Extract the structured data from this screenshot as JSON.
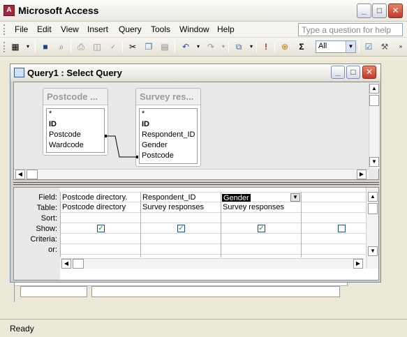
{
  "app": {
    "title": "Microsoft Access"
  },
  "menu": [
    "File",
    "Edit",
    "View",
    "Insert",
    "Query",
    "Tools",
    "Window",
    "Help"
  ],
  "ask_placeholder": "Type a question for help",
  "toolbar": {
    "filter_value": "All"
  },
  "query_window": {
    "title": "Query1 : Select Query"
  },
  "field_lists": [
    {
      "title": "Postcode ...",
      "fields": [
        "*",
        "ID",
        "Postcode",
        "Wardcode"
      ]
    },
    {
      "title": "Survey res...",
      "fields": [
        "*",
        "ID",
        "Respondent_ID",
        "Gender",
        "Postcode"
      ]
    }
  ],
  "grid": {
    "row_labels": [
      "Field:",
      "Table:",
      "Sort:",
      "Show:",
      "Criteria:",
      "or:"
    ],
    "columns": [
      {
        "field": "Postcode directory.",
        "table": "Postcode directory",
        "show": true
      },
      {
        "field": "Respondent_ID",
        "table": "Survey responses",
        "show": true
      },
      {
        "field": "Gender",
        "table": "Survey responses",
        "show": true
      },
      {
        "field": "",
        "table": "",
        "show": false
      }
    ]
  },
  "status": "Ready"
}
